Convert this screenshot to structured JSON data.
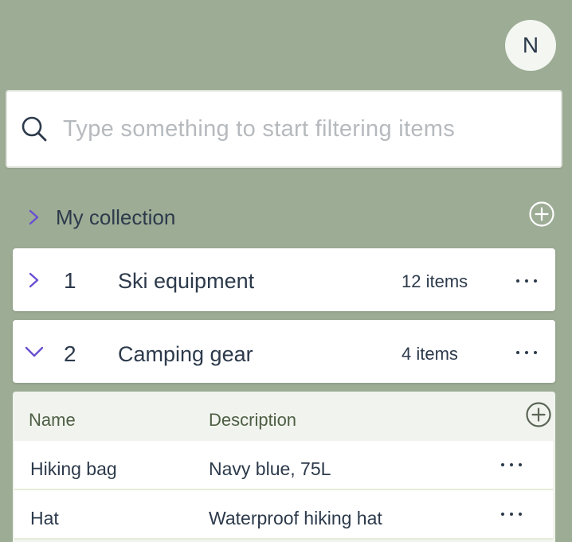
{
  "user": {
    "avatar_initial": "N"
  },
  "search": {
    "placeholder": "Type something to start filtering items",
    "value": ""
  },
  "collection": {
    "title": "My collection"
  },
  "groups": [
    {
      "number": "1",
      "name": "Ski equipment",
      "count": "12 items",
      "expanded": false
    },
    {
      "number": "2",
      "name": "Camping gear",
      "count": "4 items",
      "expanded": true
    }
  ],
  "items_table": {
    "columns": {
      "name": "Name",
      "description": "Description"
    },
    "rows": [
      {
        "name": "Hiking bag",
        "description": "Navy blue, 75L"
      },
      {
        "name": "Hat",
        "description": "Waterproof hiking hat"
      }
    ]
  },
  "icons": {
    "search": "search-icon",
    "chevron_right": "chevron-right-icon",
    "chevron_down": "chevron-down-icon",
    "add": "plus-circle-icon",
    "more": "more-horizontal-icon"
  },
  "colors": {
    "background": "#9dac95",
    "accent": "#6a4fd0",
    "text": "#2c3a4b",
    "table_header_text": "#4e5e44"
  }
}
